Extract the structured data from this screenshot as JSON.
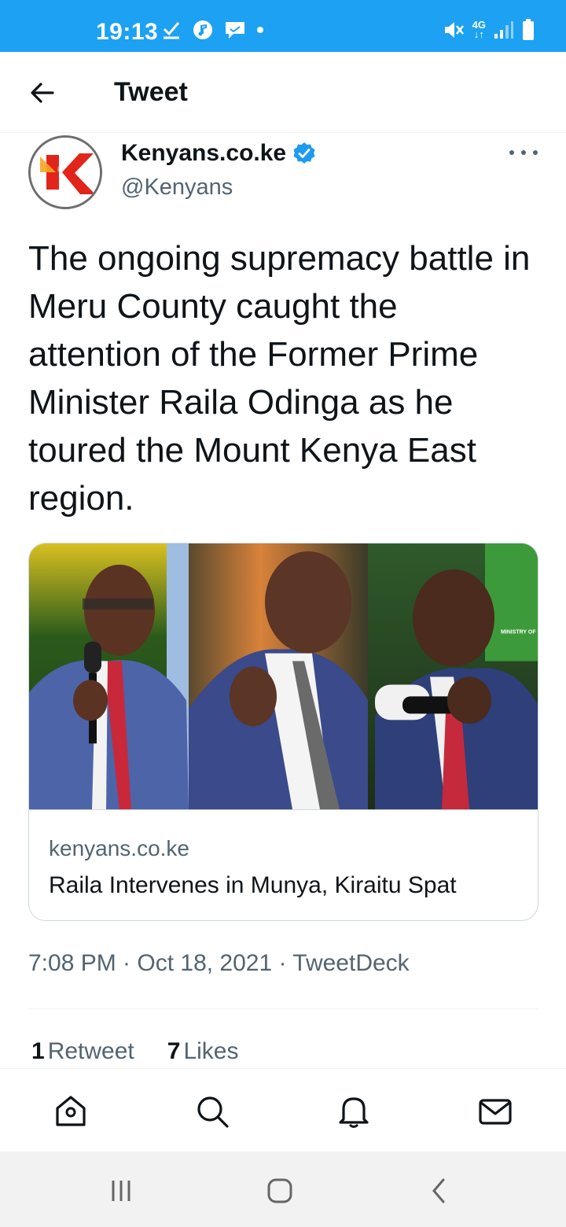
{
  "status_bar": {
    "time": "19:13",
    "network": "4G",
    "background": "#1da1f2"
  },
  "top_bar": {
    "title": "Tweet",
    "back_icon": "arrow-left-icon"
  },
  "tweet": {
    "author": {
      "name": "Kenyans.co.ke",
      "handle": "@Kenyans",
      "verified": true,
      "avatar_letter": "K"
    },
    "text": "The ongoing supremacy battle in Meru County caught the attention of the Former Prime Minister Raila Odinga as he toured the Mount Kenya East region.",
    "card": {
      "domain": "kenyans.co.ke",
      "title": "Raila Intervenes in Munya, Kiraitu Spat",
      "image_sign_text": "MINISTRY OF LIVESTOCK, COOP"
    },
    "timestamp": "7:08 PM · Oct 18, 2021 · TweetDeck",
    "stats": {
      "retweets_count": "1",
      "retweets_label": "Retweet",
      "likes_count": "7",
      "likes_label": "Likes"
    }
  },
  "bottom_nav": {
    "items": [
      "home-icon",
      "search-icon",
      "notifications-icon",
      "messages-icon"
    ]
  },
  "colors": {
    "accent": "#1da1f2",
    "verified": "#1d9bf0",
    "secondary_text": "#536471",
    "brand_red": "#e1251b"
  }
}
